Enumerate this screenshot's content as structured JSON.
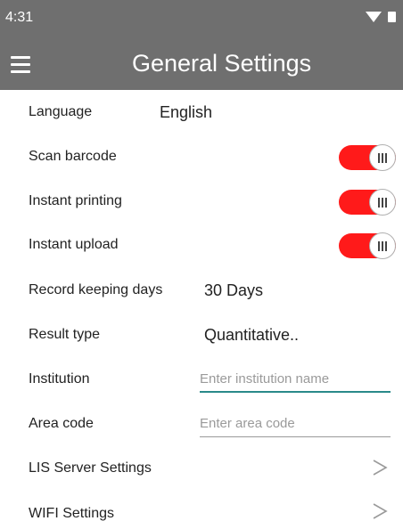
{
  "status_bar": {
    "time": "4:31"
  },
  "toolbar": {
    "title": "General Settings"
  },
  "settings": {
    "language": {
      "label": "Language",
      "value": "English"
    },
    "scan_barcode": {
      "label": "Scan barcode",
      "enabled": true
    },
    "instant_printing": {
      "label": "Instant printing",
      "enabled": true
    },
    "instant_upload": {
      "label": "Instant upload",
      "enabled": true
    },
    "record_keeping": {
      "label": "Record keeping days",
      "value": "30 Days"
    },
    "result_type": {
      "label": "Result type",
      "value": "Quantitative.."
    },
    "institution": {
      "label": "Institution",
      "value": "",
      "placeholder": "Enter institution name"
    },
    "area_code": {
      "label": "Area code",
      "value": "",
      "placeholder": "Enter area code"
    },
    "lis_server": {
      "label": "LIS Server Settings"
    },
    "wifi": {
      "label": "WIFI Settings"
    }
  },
  "colors": {
    "toolbar": "#6f6f6f",
    "toggle_on": "#ff1a1a",
    "input_focus_underline": "#2a8a8a"
  },
  "icons": {
    "menu": "hamburger-menu-icon",
    "wifi": "wifi-icon",
    "battery": "battery-icon",
    "chevron": "chevron-right-icon"
  }
}
